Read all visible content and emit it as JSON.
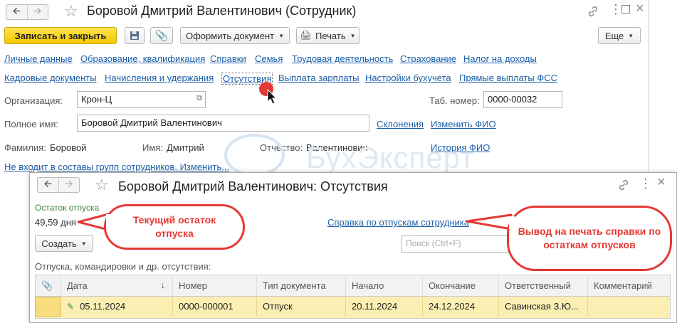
{
  "main_window": {
    "title": "Боровой Дмитрий Валентинович (Сотрудник)",
    "toolbar": {
      "save_close": "Записать и закрыть",
      "create_document": "Оформить документ",
      "print": "Печать",
      "more": "Еще"
    },
    "links_row1": [
      "Личные данные",
      "Образование, квалификация",
      "Справки",
      "Семья",
      "Трудовая деятельность",
      "Страхование",
      "Налог на доходы"
    ],
    "links_row2": [
      "Кадровые документы",
      "Начисления и удержания",
      "Отсутствия",
      "Выплата зарплаты",
      "Настройки бухучета",
      "Прямые выплаты ФСС"
    ],
    "organization_label": "Организация:",
    "organization_value": "Крон-Ц",
    "tab_number_label": "Таб. номер:",
    "tab_number_value": "0000-00032",
    "full_name_label": "Полное имя:",
    "full_name_value": "Боровой Дмитрий Валентинович",
    "declensions_link": "Склонения",
    "change_name_link": "Изменить ФИО",
    "surname_label": "Фамилия:",
    "surname_value": "Боровой",
    "name_label": "Имя:",
    "name_value": "Дмитрий",
    "patronymic_label": "Отчество:",
    "patronymic_value": "Валентинович",
    "history_link": "История ФИО",
    "groups_link": "Не входит в составы групп сотрудников. Изменить..."
  },
  "watermark": "БухЭксперт",
  "sub_window": {
    "title": "Боровой Дмитрий Валентинович: Отсутствия",
    "vacation_balance_label": "Остаток отпуска",
    "vacation_balance_value": "49,59 дня",
    "vacation_report_link": "Справка по отпускам сотрудника",
    "create_button": "Создать",
    "search_placeholder": "Поиск (Ctrl+F)",
    "list_caption": "Отпуска, командировки и др. отсутствия:",
    "table": {
      "columns": [
        "Дата",
        "Номер",
        "Тип документа",
        "Начало",
        "Окончание",
        "Ответственный",
        "Комментарий"
      ],
      "rows": [
        {
          "date": "05.11.2024",
          "number": "0000-000001",
          "type": "Отпуск",
          "start": "20.11.2024",
          "end": "24.12.2024",
          "responsible": "Савинская З.Ю...",
          "comment": ""
        }
      ]
    }
  },
  "callouts": {
    "balance": "Текущий остаток отпуска",
    "print_report": "Вывод на печать справки по остаткам отпусков"
  },
  "colors": {
    "accent_yellow": "#f5cc00",
    "link": "#1a5fa9",
    "callout_red": "#e53935",
    "selected_row": "#fbefb3"
  }
}
